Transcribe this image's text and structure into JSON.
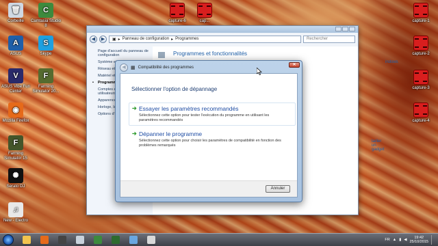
{
  "desktop": {
    "icons": [
      {
        "label": "Corbeille",
        "glyph": "🗑",
        "color": "#cfd8e3"
      },
      {
        "label": "Camtasia Studio 8",
        "glyph": "C",
        "color": "#3d8a3d"
      },
      {
        "label": "ASUS",
        "glyph": "A",
        "color": "#1f5fa8"
      },
      {
        "label": "Skype",
        "glyph": "S",
        "color": "#1ea0e0"
      },
      {
        "label": "ASUS Vibe Fun Center",
        "glyph": "V",
        "color": "#2a2a6a"
      },
      {
        "label": "Farming Simulator 20...",
        "glyph": "F",
        "color": "#556b2f"
      },
      {
        "label": "Mozilla Firefox",
        "glyph": "◉",
        "color": "#e66a1a"
      },
      {
        "label": "Farming Simulator 15",
        "glyph": "F",
        "color": "#44552a"
      },
      {
        "label": "Serato DJ",
        "glyph": "✺",
        "color": "#111111"
      },
      {
        "label": "New - Electro",
        "glyph": "♫",
        "color": "#e8e8e8"
      }
    ],
    "captures_top": [
      {
        "label": "capture-6"
      },
      {
        "label": "cap..."
      }
    ],
    "captures_right": [
      {
        "label": "capture-1"
      },
      {
        "label": "capture-2"
      },
      {
        "label": "capture-3"
      },
      {
        "label": "capture-4"
      }
    ]
  },
  "explorer": {
    "breadcrumb": [
      "Panneau de configuration",
      "Programmes"
    ],
    "search_placeholder": "Rechercher",
    "sidebar": [
      {
        "label": "Page d'accueil du panneau de configuration"
      },
      {
        "label": "Système et sécurité"
      },
      {
        "label": "Réseau et Internet"
      },
      {
        "label": "Matériel et audio"
      },
      {
        "label": "Programmes"
      },
      {
        "label": "Comptes et protection des utilisateurs"
      },
      {
        "label": "Apparence"
      },
      {
        "label": "Horloge, langue et région"
      },
      {
        "label": "Options d'ergonomie"
      }
    ],
    "section_title": "Programmes et fonctionnalités",
    "link_right": "indows",
    "link_gadget": "tailler un gadget"
  },
  "dialog": {
    "title": "Compatibilité des programmes",
    "close_label": "✕",
    "heading": "Sélectionner l'option de dépannage",
    "options": [
      {
        "title": "Essayer les paramètres recommandés",
        "description": "Sélectionnez cette option pour tester l'exécution du programme en utilisant les paramètres recommandés"
      },
      {
        "title": "Dépanner le programme",
        "description": "Sélectionnez cette option pour choisir les paramètres de compatibilité en fonction des problèmes remarqués"
      }
    ],
    "cancel_label": "Annuler"
  },
  "taskbar": {
    "apps": [
      {
        "name": "explorer-icon",
        "color": "#f2c44e"
      },
      {
        "name": "firefox-icon",
        "color": "#e66a1a"
      },
      {
        "name": "film-icon",
        "color": "#444444"
      },
      {
        "name": "printer-icon",
        "color": "#c9d2dc"
      },
      {
        "name": "camtasia-icon",
        "color": "#3d8a3d"
      },
      {
        "name": "camtasia-recorder-icon",
        "color": "#2e6b2e"
      },
      {
        "name": "control-panel-icon",
        "color": "#6aa7e0"
      },
      {
        "name": "compat-icon",
        "color": "#d9d9d9"
      }
    ],
    "lang": "FR",
    "time": "19:42",
    "date": "25/10/2015"
  }
}
